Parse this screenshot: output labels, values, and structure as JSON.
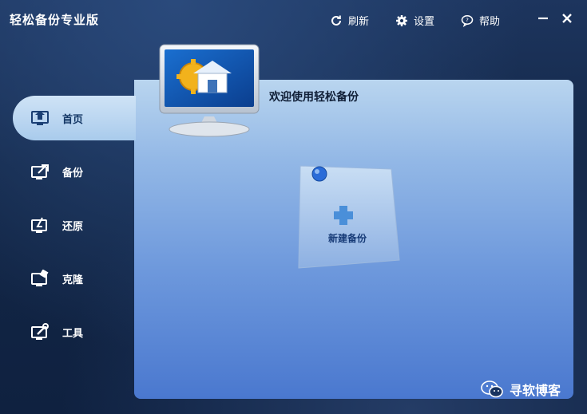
{
  "window": {
    "title": "轻松备份专业版"
  },
  "top_actions": [
    {
      "id": "refresh",
      "label": "刷新",
      "icon": "refresh-icon"
    },
    {
      "id": "settings",
      "label": "设置",
      "icon": "gear-icon"
    },
    {
      "id": "help",
      "label": "帮助",
      "icon": "help-bubble-icon"
    }
  ],
  "window_controls": [
    {
      "id": "minimize",
      "icon": "minimize-icon"
    },
    {
      "id": "close",
      "icon": "close-icon"
    }
  ],
  "sidebar": {
    "active": "home",
    "items": [
      {
        "id": "home",
        "label": "首页",
        "icon": "home-monitor-icon"
      },
      {
        "id": "backup",
        "label": "备份",
        "icon": "backup-monitor-icon"
      },
      {
        "id": "restore",
        "label": "还原",
        "icon": "restore-monitor-icon"
      },
      {
        "id": "clone",
        "label": "克隆",
        "icon": "clone-monitor-icon"
      },
      {
        "id": "tools",
        "label": "工具",
        "icon": "tools-monitor-icon"
      }
    ]
  },
  "main": {
    "welcome_text": "欢迎使用轻松备份",
    "new_backup_label": "新建备份"
  },
  "watermark": {
    "text": "寻软博客",
    "icon": "wechat-icon"
  },
  "colors": {
    "accent_blue": "#1e5fb3",
    "panel_light": "#b9d5ef",
    "panel_dark": "#4a78cf",
    "text_dark": "#0f1e36"
  }
}
